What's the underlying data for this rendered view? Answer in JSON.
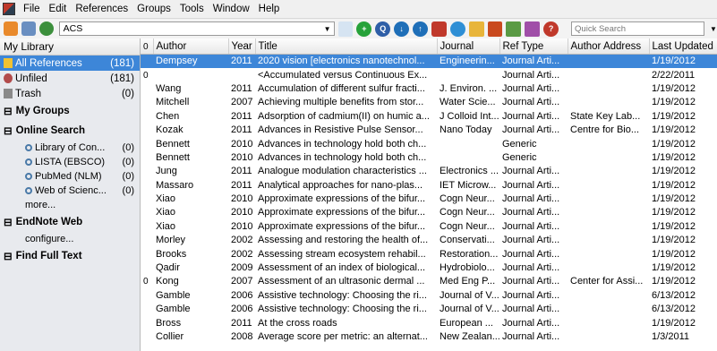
{
  "menubar": {
    "items": [
      "File",
      "Edit",
      "References",
      "Groups",
      "Tools",
      "Window",
      "Help"
    ]
  },
  "toolbar": {
    "library_select": "ACS",
    "search_placeholder": "Quick Search",
    "buttons": [
      "online-search-mode",
      "local-library-mode",
      "integrated-mode",
      "copy-to-library",
      "new-reference",
      "online-search",
      "find-full-text",
      "open-link",
      "sync",
      "globe",
      "open-folder",
      "insert-citation",
      "format-bibliography",
      "format-paper",
      "help"
    ]
  },
  "sidebar": {
    "header": "My Library",
    "items": [
      {
        "label": "All References",
        "count": "(181)",
        "selected": true
      },
      {
        "label": "Unfiled",
        "count": "(181)",
        "selected": false
      },
      {
        "label": "Trash",
        "count": "(0)",
        "selected": false
      }
    ],
    "my_groups": "My Groups",
    "online_search": {
      "title": "Online Search",
      "items": [
        {
          "label": "Library of Con...",
          "count": "(0)"
        },
        {
          "label": "LISTA (EBSCO)",
          "count": "(0)"
        },
        {
          "label": "PubMed (NLM)",
          "count": "(0)"
        },
        {
          "label": "Web of Scienc...",
          "count": "(0)"
        }
      ],
      "more": "more..."
    },
    "endnote_web": {
      "title": "EndNote Web",
      "link": "configure..."
    },
    "find_full_text": "Find Full Text"
  },
  "table": {
    "columns": [
      "",
      "Author",
      "Year",
      "Title",
      "Journal",
      "Ref Type",
      "Author Address",
      "Last Updated"
    ],
    "rows": [
      {
        "clip": "",
        "author": "Dempsey",
        "year": "2011",
        "title": "2020 vision [electronics nanotechnol...",
        "journal": "Engineerin...",
        "reftype": "Journal Arti...",
        "address": "",
        "updated": "1/19/2012",
        "selected": true
      },
      {
        "clip": "0",
        "author": "",
        "year": "",
        "title": "<Accumulated versus Continuous Ex...",
        "journal": "",
        "reftype": "Journal Arti...",
        "address": "",
        "updated": "2/22/2011"
      },
      {
        "clip": "",
        "author": "Wang",
        "year": "2011",
        "title": "Accumulation of different sulfur fracti...",
        "journal": "J. Environ. ...",
        "reftype": "Journal Arti...",
        "address": "",
        "updated": "1/19/2012"
      },
      {
        "clip": "",
        "author": "Mitchell",
        "year": "2007",
        "title": "Achieving multiple benefits from stor...",
        "journal": "Water Scie...",
        "reftype": "Journal Arti...",
        "address": "",
        "updated": "1/19/2012"
      },
      {
        "clip": "",
        "author": "Chen",
        "year": "2011",
        "title": "Adsorption of cadmium(II) on humic a...",
        "journal": "J Colloid Int...",
        "reftype": "Journal Arti...",
        "address": "State Key Lab...",
        "updated": "1/19/2012"
      },
      {
        "clip": "",
        "author": "Kozak",
        "year": "2011",
        "title": "Advances in Resistive Pulse Sensor...",
        "journal": "Nano Today",
        "reftype": "Journal Arti...",
        "address": "Centre for Bio...",
        "updated": "1/19/2012"
      },
      {
        "clip": "",
        "author": "Bennett",
        "year": "2010",
        "title": "Advances in technology hold both ch...",
        "journal": "",
        "reftype": "Generic",
        "address": "",
        "updated": "1/19/2012"
      },
      {
        "clip": "",
        "author": "Bennett",
        "year": "2010",
        "title": "Advances in technology hold both ch...",
        "journal": "",
        "reftype": "Generic",
        "address": "",
        "updated": "1/19/2012"
      },
      {
        "clip": "",
        "author": "Jung",
        "year": "2011",
        "title": "Analogue modulation characteristics ...",
        "journal": "Electronics ...",
        "reftype": "Journal Arti...",
        "address": "",
        "updated": "1/19/2012"
      },
      {
        "clip": "",
        "author": "Massaro",
        "year": "2011",
        "title": "Analytical approaches for nano-plas...",
        "journal": "IET Microw...",
        "reftype": "Journal Arti...",
        "address": "",
        "updated": "1/19/2012"
      },
      {
        "clip": "",
        "author": "Xiao",
        "year": "2010",
        "title": "Approximate expressions of the bifur...",
        "journal": "Cogn Neur...",
        "reftype": "Journal Arti...",
        "address": "",
        "updated": "1/19/2012"
      },
      {
        "clip": "",
        "author": "Xiao",
        "year": "2010",
        "title": "Approximate expressions of the bifur...",
        "journal": "Cogn Neur...",
        "reftype": "Journal Arti...",
        "address": "",
        "updated": "1/19/2012"
      },
      {
        "clip": "",
        "author": "Xiao",
        "year": "2010",
        "title": "Approximate expressions of the bifur...",
        "journal": "Cogn Neur...",
        "reftype": "Journal Arti...",
        "address": "",
        "updated": "1/19/2012"
      },
      {
        "clip": "",
        "author": "Morley",
        "year": "2002",
        "title": "Assessing and restoring the health of...",
        "journal": "Conservati...",
        "reftype": "Journal Arti...",
        "address": "",
        "updated": "1/19/2012"
      },
      {
        "clip": "",
        "author": "Brooks",
        "year": "2002",
        "title": "Assessing stream ecosystem rehabil...",
        "journal": "Restoration...",
        "reftype": "Journal Arti...",
        "address": "",
        "updated": "1/19/2012"
      },
      {
        "clip": "",
        "author": "Qadir",
        "year": "2009",
        "title": "Assessment of an index of biological...",
        "journal": "Hydrobiolo...",
        "reftype": "Journal Arti...",
        "address": "",
        "updated": "1/19/2012"
      },
      {
        "clip": "0",
        "author": "Kong",
        "year": "2007",
        "title": "Assessment of an ultrasonic dermal ...",
        "journal": "Med Eng P...",
        "reftype": "Journal Arti...",
        "address": "Center for Assi...",
        "updated": "1/19/2012"
      },
      {
        "clip": "",
        "author": "Gamble",
        "year": "2006",
        "title": "Assistive technology: Choosing the ri...",
        "journal": "Journal of V...",
        "reftype": "Journal Arti...",
        "address": "",
        "updated": "6/13/2012"
      },
      {
        "clip": "",
        "author": "Gamble",
        "year": "2006",
        "title": "Assistive technology: Choosing the ri...",
        "journal": "Journal of V...",
        "reftype": "Journal Arti...",
        "address": "",
        "updated": "6/13/2012"
      },
      {
        "clip": "",
        "author": "Bross",
        "year": "2011",
        "title": "At the cross roads",
        "journal": "European ...",
        "reftype": "Journal Arti...",
        "address": "",
        "updated": "1/19/2012"
      },
      {
        "clip": "",
        "author": "Collier",
        "year": "2008",
        "title": "Average score per metric: an alternat...",
        "journal": "New Zealan...",
        "reftype": "Journal Arti...",
        "address": "",
        "updated": "1/3/2011"
      }
    ]
  },
  "colors": {
    "selection": "#3d86d8",
    "sidebar_bg": "#e8eaee",
    "header_bg": "#f0f0f0"
  }
}
